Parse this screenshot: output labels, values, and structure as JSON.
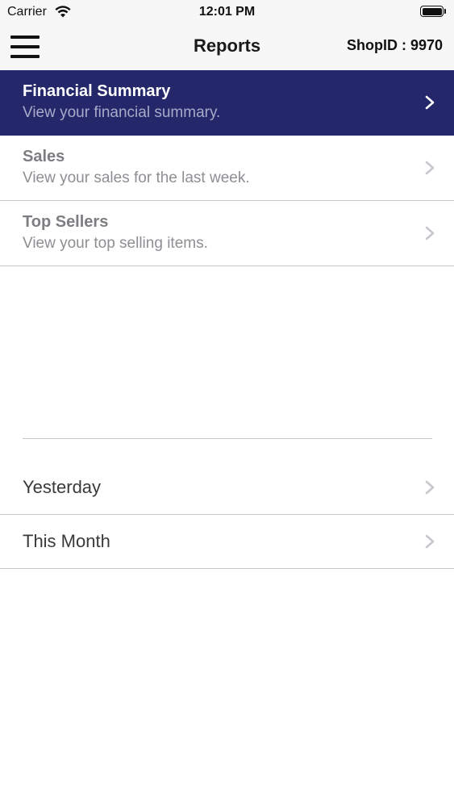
{
  "status_bar": {
    "carrier": "Carrier",
    "time": "12:01 PM",
    "wifi_icon": "wifi-icon",
    "battery_icon": "battery-icon"
  },
  "nav": {
    "menu_icon": "hamburger-menu-icon",
    "title": "Reports",
    "shop_id": "ShopID : 9970"
  },
  "reports": [
    {
      "title": "Financial Summary",
      "subtitle": "View your financial summary.",
      "selected": true
    },
    {
      "title": "Sales",
      "subtitle": "View your sales for the last week.",
      "selected": false
    },
    {
      "title": "Top Sellers",
      "subtitle": "View your top selling items.",
      "selected": false
    }
  ],
  "periods": [
    {
      "label": "Yesterday"
    },
    {
      "label": "This Month"
    }
  ],
  "colors": {
    "selected_row": "#24276a",
    "bar_background": "#f7f7f7",
    "separator": "#c8c8cc",
    "chevron": "#c7c7cc",
    "chevron_selected": "#ffffff"
  }
}
